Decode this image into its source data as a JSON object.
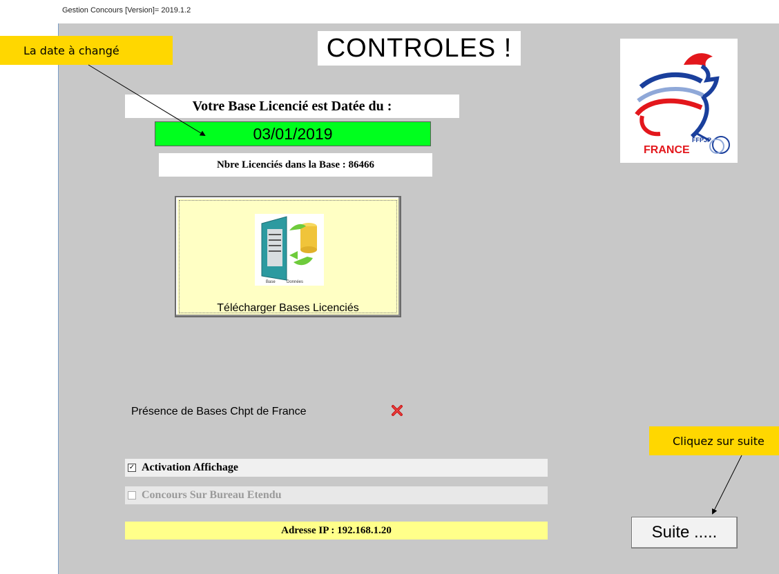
{
  "window": {
    "title": "Gestion Concours [Version]= 2019.1.2"
  },
  "header": {
    "title": "CONTROLES !"
  },
  "base_info": {
    "label": "Votre Base Licencié est Datée du :",
    "date": "03/01/2019",
    "count_label": "Nbre Licenciés dans la Base : 86466"
  },
  "logo": {
    "brand_small": "FFPJP",
    "brand": "FRANCE"
  },
  "download": {
    "icon_caption_1": "Base",
    "icon_caption_2": "Données",
    "label": "Télécharger Bases Licenciés"
  },
  "presence": {
    "label": "Présence de Bases Chpt de France",
    "status_icon": "red-x-icon"
  },
  "options": {
    "activation_label": "Activation Affichage",
    "activation_checked": true,
    "bureau_label": "Concours Sur Bureau Etendu",
    "bureau_checked": false
  },
  "ip": {
    "label": "Adresse IP : 192.168.1.20"
  },
  "suite": {
    "label": "Suite ....."
  },
  "annotations": {
    "date_changed": "La date à changé",
    "click_suite": "Cliquez sur suite"
  },
  "colors": {
    "window_bg": "#c8c8c8",
    "date_bg": "#00ff1e",
    "button_bg": "#ffffc4",
    "ip_bg": "#ffff8a",
    "callout_bg": "#ffd700"
  }
}
